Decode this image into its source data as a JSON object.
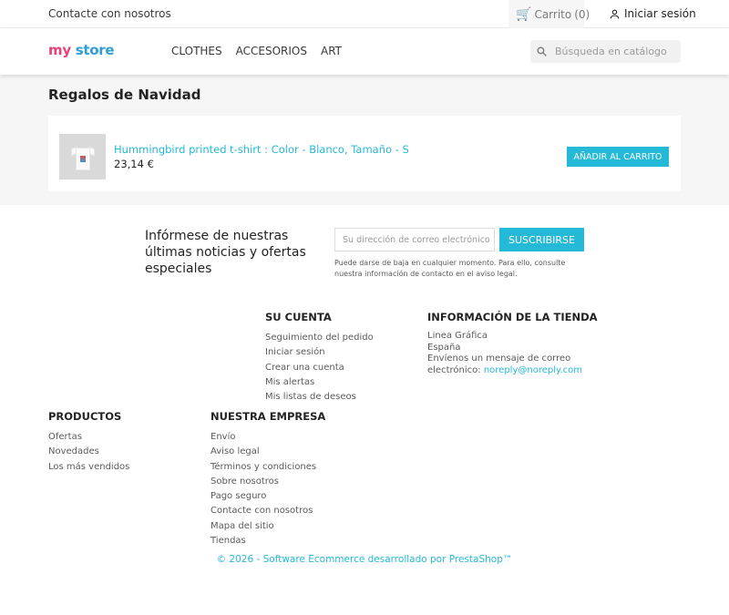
{
  "topbar": {
    "contact": "Contacte con nosotros",
    "cart_label": "Carrito",
    "cart_count": "(0)",
    "login": "Iniciar sesión"
  },
  "header": {
    "logo_my": "my",
    "logo_store": "store",
    "nav": [
      "CLOTHES",
      "ACCESORIOS",
      "ART"
    ],
    "search_placeholder": "Búsqueda en catálogo"
  },
  "main": {
    "title": "Regalos de Navidad",
    "product": {
      "name": "Hummingbird printed t-shirt : Color - Blanco, Tamaño - S",
      "price": "23,14 €",
      "add_button": "AÑADIR AL CARRITO"
    }
  },
  "newsletter": {
    "heading": "Infórmese de nuestras últimas noticias y ofertas especiales",
    "email_placeholder": "Su dirección de correo electrónico",
    "subscribe": "SUSCRIBIRSE",
    "note": "Puede darse de baja en cualquier momento. Para ello, consulte nuestra información de contacto en el aviso legal."
  },
  "footer": {
    "account": {
      "title": "SU CUENTA",
      "links": [
        "Seguimiento del pedido",
        "Iniciar sesión",
        "Crear una cuenta",
        "Mis alertas",
        "Mis listas de deseos"
      ]
    },
    "store_info": {
      "title": "INFORMACIÓN DE LA TIENDA",
      "line1": "Linea Gráfica",
      "line2": "España",
      "line3": "Envíenos un mensaje de correo",
      "line4_prefix": "electrónico:",
      "email": "noreply@noreply.com"
    },
    "products": {
      "title": "PRODUCTOS",
      "links": [
        "Ofertas",
        "Novedades",
        "Los más vendidos"
      ]
    },
    "company": {
      "title": "NUESTRA EMPRESA",
      "links": [
        "Envío",
        "Aviso legal",
        "Términos y condiciones",
        "Sobre nosotros",
        "Pago seguro",
        "Contacte con nosotros",
        "Mapa del sitio",
        "Tiendas"
      ]
    },
    "copyright": "© 2026 - Software Ecommerce desarrollado por PrestaShop™"
  },
  "colors": {
    "accent": "#24b9d7",
    "background_light": "#f6f6f6"
  },
  "icons": {
    "cart": "shopping-cart-icon",
    "user": "user-icon",
    "search": "search-icon"
  }
}
